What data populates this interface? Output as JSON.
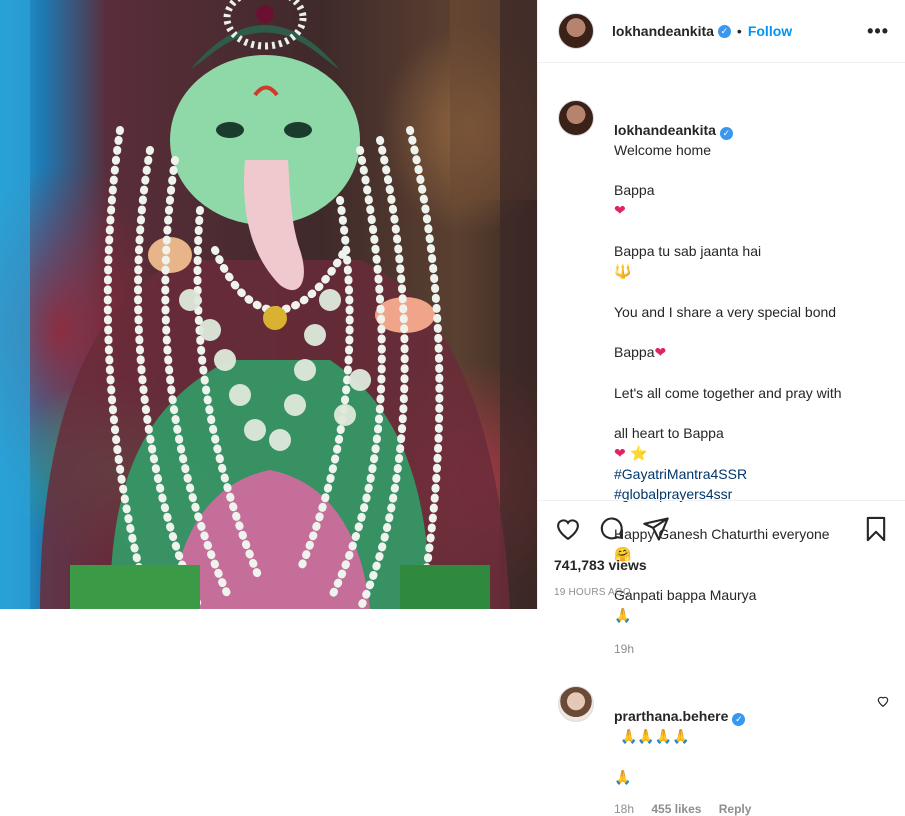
{
  "post": {
    "media_description": "video",
    "author": {
      "username": "lokhandeankita",
      "verified": true,
      "follow_label": "Follow",
      "separator": "•",
      "more_label": "•••"
    },
    "caption": {
      "username": "lokhandeankita",
      "lines": [
        {
          "text": "Welcome home"
        },
        {
          "text": "Bappa",
          "emoji": "❤"
        },
        {
          "text": "Bappa tu sab jaanta hai",
          "emoji": "🔱"
        },
        {
          "text": ""
        },
        {
          "text": "You and I share a very special bond"
        },
        {
          "text": "Bappa",
          "emoji": "❤"
        },
        {
          "text": ""
        },
        {
          "text": "Let's all come together and pray with"
        },
        {
          "text": "all heart to Bappa",
          "emoji": "❤ ⭐"
        }
      ],
      "hashtags": [
        "#GayatriMantra4SSR",
        "#globalprayers4ssr"
      ],
      "closing": [
        {
          "text": "Happy Ganesh Chaturthi everyone",
          "emoji": "🤗"
        },
        {
          "text": "Ganpati bappa Maurya",
          "emoji": "🙏"
        }
      ],
      "time": "19h"
    },
    "comment": {
      "username": "prarthana.behere",
      "verified": true,
      "text": "🙏🙏🙏🙏",
      "text2": "🙏",
      "time": "18h",
      "likes": "455 likes",
      "reply_label": "Reply"
    },
    "stats": {
      "views": "741,783 views",
      "ago": "19 HOURS AGO"
    },
    "colors": {
      "link": "#0095f6",
      "hashtag": "#00376b",
      "verified": "#3897f0",
      "muted": "#8e8e8e",
      "heart": "#e0245e"
    }
  }
}
